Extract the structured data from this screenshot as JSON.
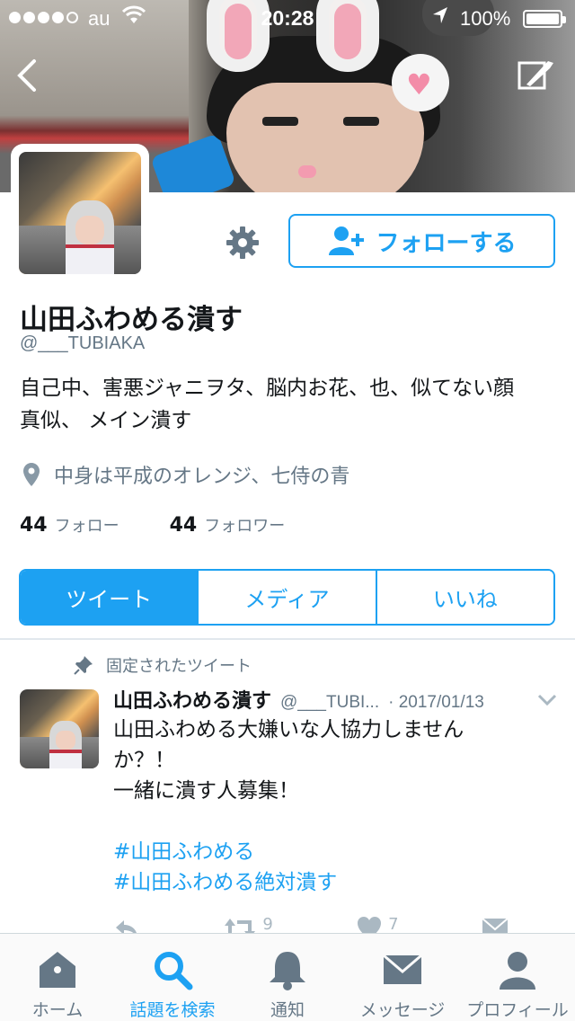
{
  "status_bar": {
    "carrier": "au",
    "time": "20:28",
    "battery": "100%"
  },
  "profile": {
    "follow_label": "フォローする",
    "display_name": "山田ふわめる潰す",
    "screen_name": "@___TUBIAKA",
    "bio_line1": "自己中、害悪ジャニヲタ、脳内お花、也、似てない顔",
    "bio_line2": "真似、 メイン潰す",
    "location": "中身は平成のオレンジ、七侍の青",
    "following_count": "44",
    "following_label": "フォロー",
    "followers_count": "44",
    "followers_label": "フォロワー"
  },
  "tabs": [
    {
      "label": "ツイート",
      "active": true
    },
    {
      "label": "メディア",
      "active": false
    },
    {
      "label": "いいね",
      "active": false
    }
  ],
  "pinned_tweet": {
    "pinned_label": "固定されたツイート",
    "name": "山田ふわめる潰す",
    "handle": "@___TUBI...",
    "date": "· 2017/01/13",
    "lines": [
      "山田ふわめる大嫌いな人協力しません",
      "か？！",
      "一緒に潰す人募集！",
      "",
      "#山田ふわめる",
      "#山田ふわめる絶対潰す"
    ],
    "retweet_count": "9",
    "like_count": "7"
  },
  "tab_bar": [
    {
      "label": "ホーム",
      "icon": "home-icon",
      "active": false
    },
    {
      "label": "話題を検索",
      "icon": "search-icon",
      "active": true
    },
    {
      "label": "通知",
      "icon": "bell-icon",
      "active": false
    },
    {
      "label": "メッセージ",
      "icon": "mail-icon",
      "active": false
    },
    {
      "label": "プロフィール",
      "icon": "person-icon",
      "active": false
    }
  ],
  "colors": {
    "accent": "#1da1f2",
    "secondary_text": "#657786",
    "primary_text": "#14171a"
  }
}
